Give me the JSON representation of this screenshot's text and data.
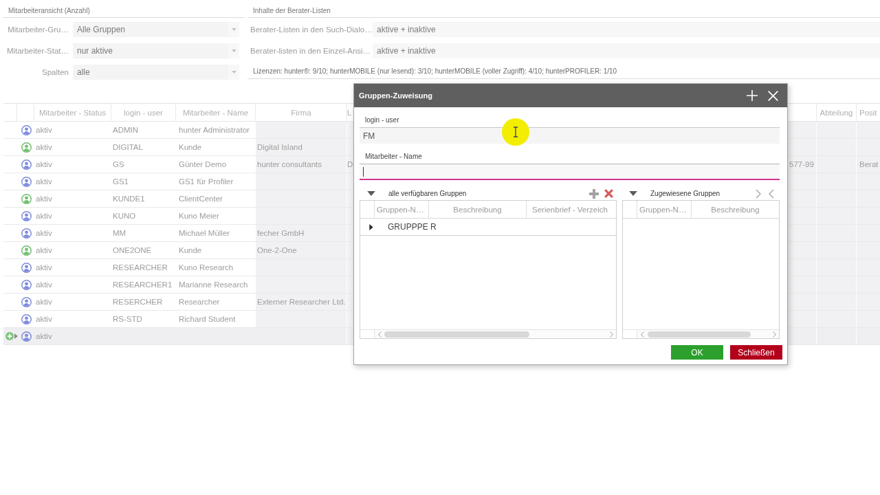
{
  "employee_view": {
    "title": "Mitarbeiteransicht (Anzahl)",
    "fields": [
      {
        "label": "Mitarbeiter-Gru…",
        "value": "Alle Gruppen"
      },
      {
        "label": "Mitarbeiter-Stat…",
        "value": "nur aktive"
      },
      {
        "label": "Spalten",
        "value": "alle"
      }
    ]
  },
  "adviser_lists": {
    "title": "Inhalte der Berater-Listen",
    "fields": [
      {
        "label": "Berater-Listen in den Such-Dialo…",
        "value": "aktive + inaktive"
      },
      {
        "label": "Berater-listen in den Einzel-Ansi…",
        "value": "aktive + inaktive"
      }
    ],
    "licenses": "Lizenzen: hunter®: 9/10; hunterMOBILE (nur lesend): 3/10; hunterMOBILE (voller Zugriff): 4/10; hunterPROFILER: 1/10"
  },
  "table": {
    "columns": {
      "status": "Mitarbeiter - Status",
      "login_user": "login - user",
      "name": "Mitarbeiter - Name",
      "firma": "Firma",
      "column_7": "L",
      "abteilung": "Abteilung",
      "column_10": "Posit"
    },
    "rows": [
      {
        "kind": "record",
        "selected": false,
        "color": "#7f8cdc",
        "status": "aktiv",
        "login_user": "ADMIN",
        "name": "hunter Administrator"
      },
      {
        "kind": "record",
        "selected": false,
        "color": "#72bf72",
        "status": "aktiv",
        "login_user": "DIGITAL",
        "name": "Kunde",
        "firma": "Digital Island"
      },
      {
        "kind": "record",
        "selected": false,
        "color": "#7f8cdc",
        "status": "aktiv",
        "login_user": "GS",
        "name": "Günter Demo",
        "firma": "hunter consultants",
        "column_7": "D",
        "column_8": "577-99",
        "column_10": "Berat"
      },
      {
        "kind": "record",
        "selected": false,
        "color": "#7f8cdc",
        "status": "aktiv",
        "login_user": "GS1",
        "name": "GS1 für Profiler"
      },
      {
        "kind": "record",
        "selected": false,
        "color": "#72bf72",
        "status": "aktiv",
        "login_user": "KUNDE1",
        "name": "ClientCenter"
      },
      {
        "kind": "record",
        "selected": false,
        "color": "#7f8cdc",
        "status": "aktiv",
        "login_user": "KUNO",
        "name": "Kuno Meier"
      },
      {
        "kind": "record",
        "selected": false,
        "color": "#7f8cdc",
        "status": "aktiv",
        "login_user": "MM",
        "name": "Michael Müller",
        "firma": "fecher GmbH"
      },
      {
        "kind": "record",
        "selected": false,
        "color": "#72bf72",
        "status": "aktiv",
        "login_user": "ONE2ONE",
        "name": "Kunde",
        "firma": "One-2-One"
      },
      {
        "kind": "record",
        "selected": false,
        "color": "#7f8cdc",
        "status": "aktiv",
        "login_user": "RESEARCHER",
        "name": "Kuno Research"
      },
      {
        "kind": "record",
        "selected": false,
        "color": "#7f8cdc",
        "status": "aktiv",
        "login_user": "RESEARCHER1",
        "name": "Marianne Research"
      },
      {
        "kind": "record",
        "selected": false,
        "color": "#7f8cdc",
        "status": "aktiv",
        "login_user": "RESERCHER",
        "name": "Researcher",
        "firma": "Externer Researcher Ltd."
      },
      {
        "kind": "record",
        "selected": false,
        "color": "#7f8cdc",
        "status": "aktiv",
        "login_user": "RS-STD",
        "name": "Richard Student"
      },
      {
        "kind": "new",
        "selected": true,
        "color": "#7f8cdc",
        "status": "aktiv"
      }
    ]
  },
  "dialog": {
    "title": "Gruppen-Zuweisung",
    "fields": [
      {
        "label": "login - user",
        "value": "FM",
        "focused": false
      },
      {
        "label": "Mitarbeiter - Name",
        "focused": true
      }
    ],
    "available_groups": {
      "title": "alle verfügbaren Gruppen",
      "expanded": true,
      "columns": [
        "Gruppen-N…",
        "Beschreibung",
        "Serienbrief - Verzeich"
      ],
      "rows": [
        {
          "name": "GRUPPPE R",
          "expanded": false
        }
      ]
    },
    "assigned_groups": {
      "title": "Zugewiesene Gruppen",
      "expanded": true,
      "columns": [
        "Gruppen-N…",
        "Beschreibung"
      ]
    },
    "buttons": [
      {
        "label": "OK",
        "kind": "confirm"
      },
      {
        "label": "Schließen",
        "kind": "cancel"
      }
    ]
  }
}
